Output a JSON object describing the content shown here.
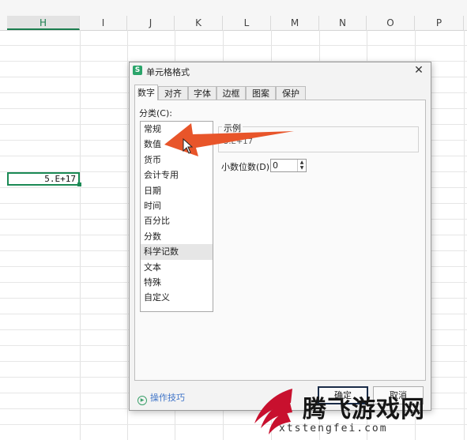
{
  "sheet": {
    "columns": [
      "H",
      "I",
      "J",
      "K",
      "L",
      "M",
      "N",
      "O",
      "P"
    ],
    "active_column": "H",
    "selected_cell_value": "5.E+17"
  },
  "dialog": {
    "title": "单元格格式",
    "tabs": [
      "数字",
      "对齐",
      "字体",
      "边框",
      "图案",
      "保护"
    ],
    "active_tab": "数字",
    "category_label": "分类(C):",
    "categories": [
      "常规",
      "数值",
      "货币",
      "会计专用",
      "日期",
      "时间",
      "百分比",
      "分数",
      "科学记数",
      "文本",
      "特殊",
      "自定义"
    ],
    "selected_category": "科学记数",
    "sample_label": "示例",
    "sample_value": "5.E+17",
    "decimal_label": "小数位数(D):",
    "decimal_value": "0",
    "tips_label": "操作技巧",
    "ok_label": "确定",
    "cancel_label": "取消"
  },
  "watermark": {
    "text": "腾飞游戏网",
    "url": "xtstengfei.com"
  },
  "colors": {
    "accent": "#1b8a55",
    "arrow": "#e8552a"
  },
  "icons": {
    "close": "close-icon",
    "app": "sheet-app-icon",
    "tips": "play-circle-icon"
  }
}
